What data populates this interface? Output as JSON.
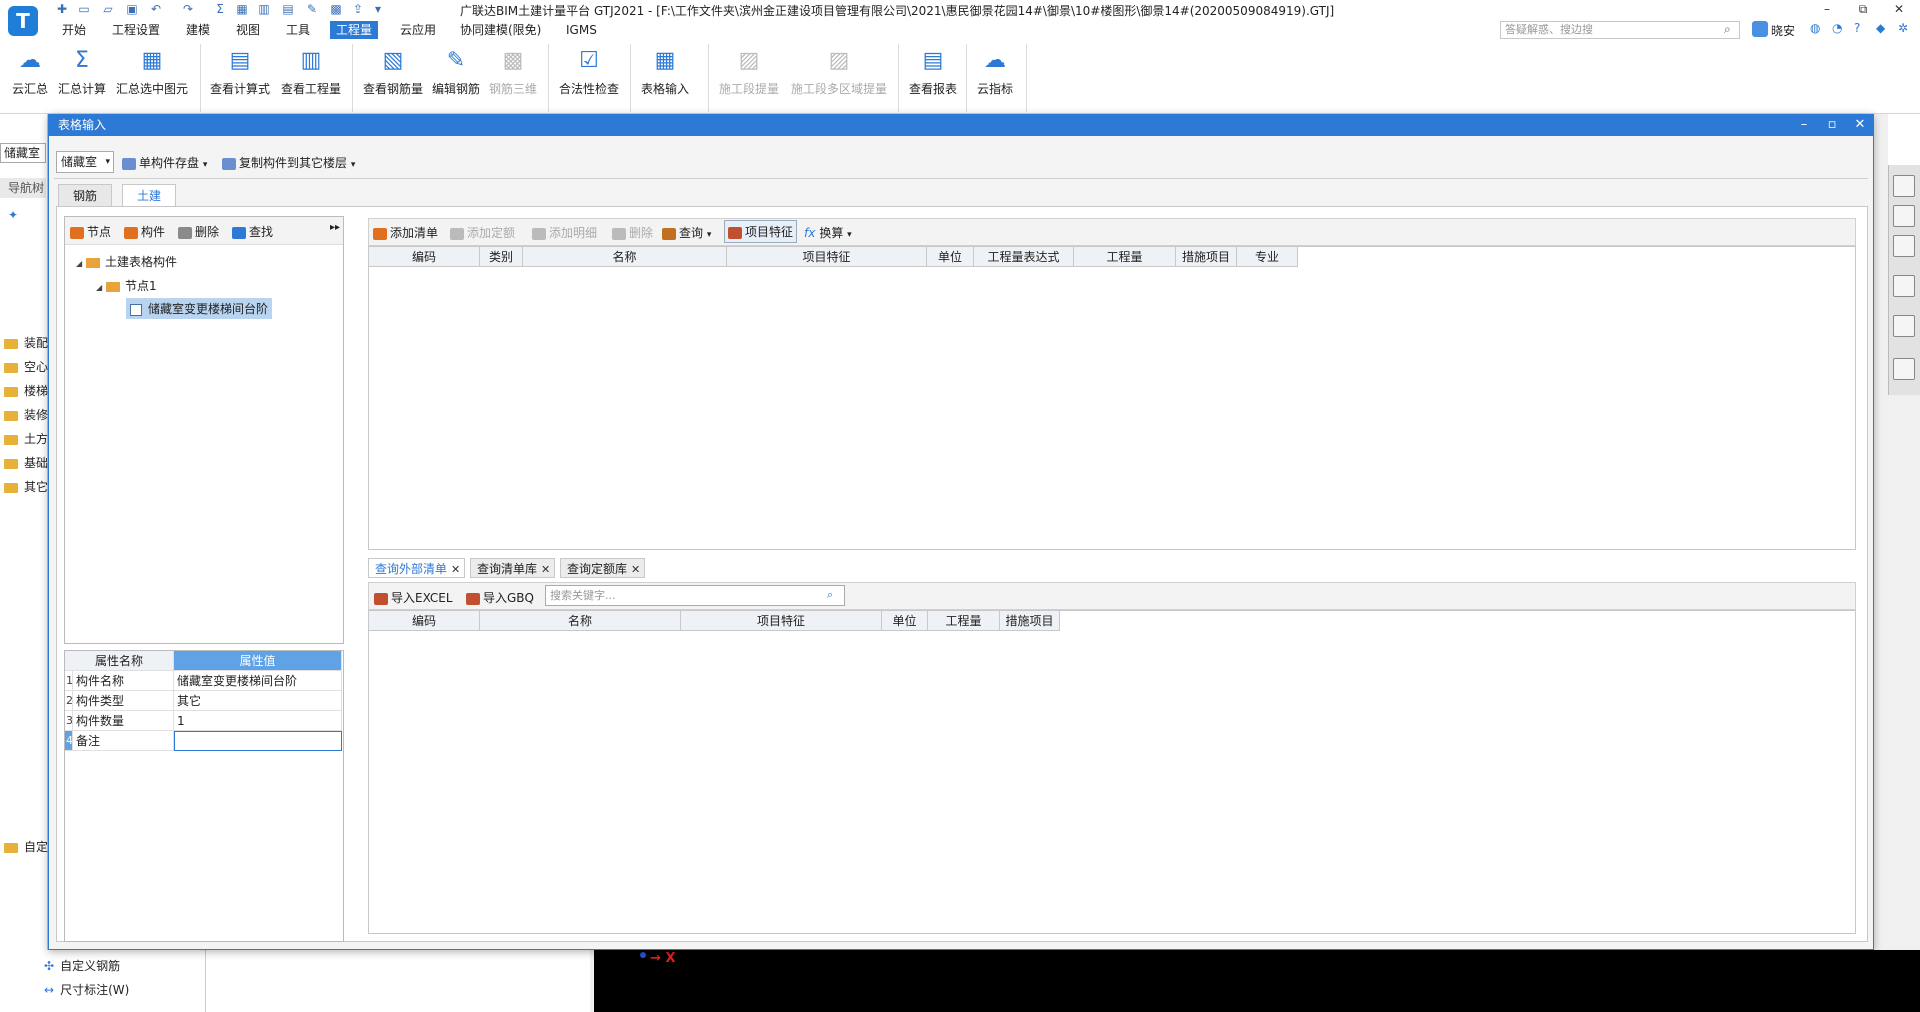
{
  "app": {
    "title": "广联达BIM土建计量平台 GTJ2021 - [F:\\工作文件夹\\滨州金正建设项目管理有限公司\\2021\\惠民御景花园14#\\御景\\10#楼图形\\御景14#(20200509084919).GTJ]",
    "logo": "T",
    "window_controls": {
      "minimize": "–",
      "restore": "⧉",
      "close": "✕"
    },
    "search_placeholder": "答疑解惑、搜边搜",
    "user_name": "晓安",
    "top_icons": [
      "chat-icon",
      "headset-icon",
      "help-icon",
      "shirt-icon",
      "settings-icon"
    ]
  },
  "menu": {
    "items": [
      "开始",
      "工程设置",
      "建模",
      "视图",
      "工具",
      "工程量",
      "云应用",
      "协同建模(限免)",
      "IGMS"
    ],
    "active": "工程量"
  },
  "ribbon": {
    "buttons": [
      {
        "label": "云汇总",
        "icon": "☁"
      },
      {
        "label": "汇总计算",
        "icon": "Σ"
      },
      {
        "label": "汇总选中图元",
        "icon": "▦"
      },
      {
        "label": "查看计算式",
        "icon": "▤"
      },
      {
        "label": "查看工程量",
        "icon": "▥"
      },
      {
        "label": "查看钢筋量",
        "icon": "▧"
      },
      {
        "label": "编辑钢筋",
        "icon": "✎"
      },
      {
        "label": "钢筋三维",
        "icon": "▩"
      },
      {
        "label": "合法性检查",
        "icon": "☑"
      },
      {
        "label": "表格输入",
        "icon": "▦"
      },
      {
        "label": "施工段提量",
        "icon": "▨"
      },
      {
        "label": "施工段多区域提量",
        "icon": "▨"
      },
      {
        "label": "查看报表",
        "icon": "▤"
      },
      {
        "label": "云指标",
        "icon": "☁"
      }
    ]
  },
  "workspace": {
    "floor_combo": "储藏室",
    "nav_tab": "导航树",
    "categories": [
      "装配",
      "空心",
      "楼梯",
      "装修",
      "土方",
      "基础",
      "其它",
      "自定"
    ],
    "bottom_list": [
      "自定义钢筋",
      "尺寸标注(W)"
    ],
    "axis_label": "X"
  },
  "dialog": {
    "title": "表格输入",
    "floor_combo": "储藏室",
    "save_btn": "单构件存盘",
    "copy_btn": "复制构件到其它楼层",
    "tabs": [
      "钢筋",
      "土建"
    ],
    "active_tab": "土建",
    "tree_toolbar": [
      "节点",
      "构件",
      "删除",
      "查找"
    ],
    "tree": {
      "root": "土建表格构件",
      "node": "节点1",
      "leaf": "储藏室变更楼梯间台阶"
    },
    "prop_grid": {
      "headers": [
        "属性名称",
        "属性值"
      ],
      "rows": [
        {
          "num": "1",
          "name": "构件名称",
          "value": "储藏室变更楼梯间台阶"
        },
        {
          "num": "2",
          "name": "构件类型",
          "value": "其它"
        },
        {
          "num": "3",
          "name": "构件数量",
          "value": "1"
        },
        {
          "num": "4",
          "name": "备注",
          "value": ""
        }
      ]
    },
    "list_toolbar": [
      {
        "label": "添加清单",
        "disabled": false
      },
      {
        "label": "添加定额",
        "disabled": true
      },
      {
        "label": "添加明细",
        "disabled": true
      },
      {
        "label": "删除",
        "disabled": true
      },
      {
        "label": "查询",
        "disabled": false
      },
      {
        "label": "项目特征",
        "disabled": false
      },
      {
        "label": "换算",
        "disabled": false
      }
    ],
    "upper_columns": [
      "编码",
      "类别",
      "名称",
      "项目特征",
      "单位",
      "工程量表达式",
      "工程量",
      "措施项目",
      "专业"
    ],
    "lower_tabs": [
      "查询外部清单",
      "查询清单库",
      "查询定额库"
    ],
    "lower_active": "查询外部清单",
    "import_excel": "导入EXCEL",
    "import_gbq": "导入GBQ",
    "keyword_placeholder": "搜索关键字...",
    "lower_columns": [
      "编码",
      "名称",
      "项目特征",
      "单位",
      "工程量",
      "措施项目"
    ]
  }
}
